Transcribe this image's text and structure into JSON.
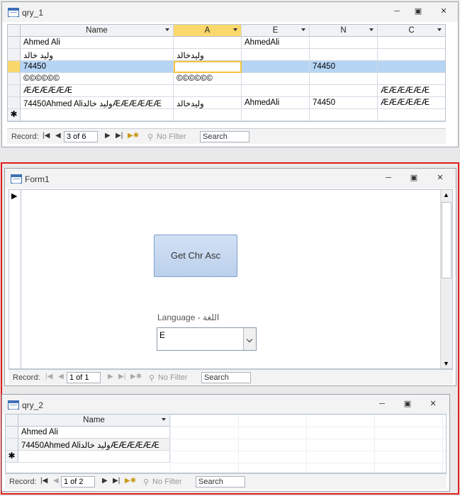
{
  "qry1": {
    "title": "qry_1",
    "columns": [
      "Name",
      "A",
      "E",
      "N",
      "C"
    ],
    "rows": [
      [
        "Ahmed Ali",
        "",
        "AhmedAli",
        "",
        ""
      ],
      [
        "وليد خالد",
        "وليدخالد",
        "",
        "",
        ""
      ],
      [
        "74450",
        "",
        "",
        "74450",
        ""
      ],
      [
        "©©©©©©",
        "©©©©©©",
        "",
        "",
        ""
      ],
      [
        "ÆÆÆÆÆÆ",
        "",
        "",
        "",
        "ÆÆÆÆÆÆ"
      ],
      [
        "74450Ahmed Aliوليد خالدÆÆÆÆÆÆ",
        "وليدخالد",
        "AhmedAli",
        "74450",
        " ÆÆÆÆÆÆ"
      ]
    ],
    "new_row_symbol": "✱",
    "current_row_symbol": "",
    "nav": {
      "label": "Record:",
      "position": "3 of 6",
      "filter": "No Filter",
      "search": "Search"
    }
  },
  "form1": {
    "title": "Form1",
    "button_label": "Get Chr Asc",
    "combo_label": "Language - اللغة",
    "combo_value": "E",
    "record_marker": "▶",
    "nav": {
      "label": "Record:",
      "position": "1 of 1",
      "filter": "No Filter",
      "search": "Search"
    }
  },
  "qry2": {
    "title": "qry_2",
    "columns": [
      "Name"
    ],
    "rows": [
      [
        "Ahmed Ali"
      ],
      [
        "74450Ahmed Aliوليد خالدÆÆÆÆÆÆ"
      ]
    ],
    "new_row_symbol": "✱",
    "nav": {
      "label": "Record:",
      "position": "1 of 2",
      "filter": "No Filter",
      "search": "Search"
    }
  },
  "window_buttons": {
    "minimize": "─",
    "restore": "▣",
    "close": "✕"
  },
  "highlight_color": "#e21b1b"
}
